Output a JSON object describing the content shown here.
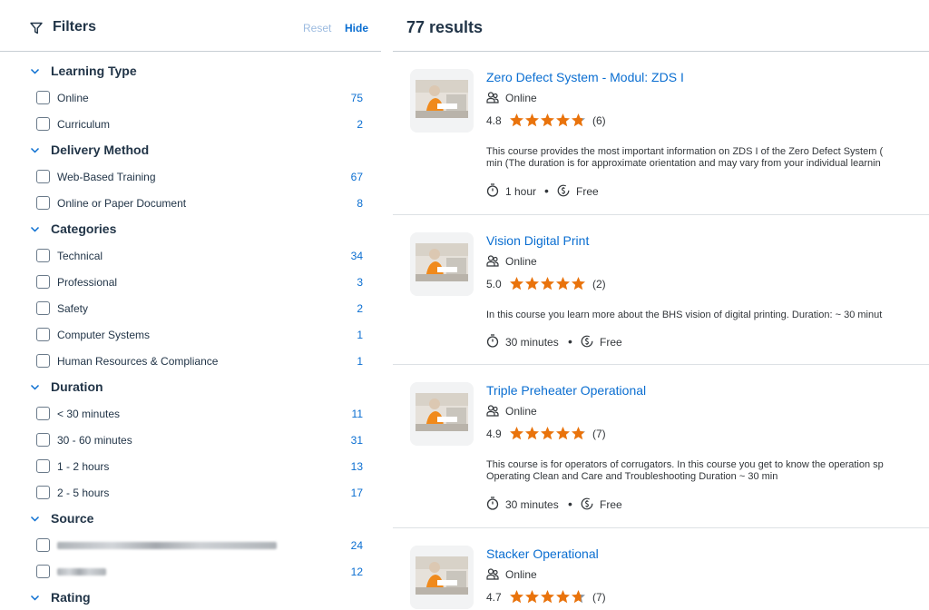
{
  "filters": {
    "title": "Filters",
    "reset_label": "Reset",
    "hide_label": "Hide",
    "groups": [
      {
        "title": "Learning Type",
        "options": [
          {
            "label": "Online",
            "count": "75"
          },
          {
            "label": "Curriculum",
            "count": "2"
          }
        ]
      },
      {
        "title": "Delivery Method",
        "options": [
          {
            "label": "Web-Based Training",
            "count": "67"
          },
          {
            "label": "Online or Paper Document",
            "count": "8"
          }
        ]
      },
      {
        "title": "Categories",
        "options": [
          {
            "label": "Technical",
            "count": "34"
          },
          {
            "label": "Professional",
            "count": "3"
          },
          {
            "label": "Safety",
            "count": "2"
          },
          {
            "label": "Computer Systems",
            "count": "1"
          },
          {
            "label": "Human Resources & Compliance",
            "count": "1"
          }
        ]
      },
      {
        "title": "Duration",
        "options": [
          {
            "label": "< 30 minutes",
            "count": "11"
          },
          {
            "label": "30 - 60 minutes",
            "count": "31"
          },
          {
            "label": "1 - 2 hours",
            "count": "13"
          },
          {
            "label": "2 - 5 hours",
            "count": "17"
          }
        ]
      },
      {
        "title": "Source",
        "options": [
          {
            "label": "",
            "count": "24",
            "blurred": true
          },
          {
            "label": "",
            "count": "12",
            "blurred": true
          }
        ]
      },
      {
        "title": "Rating",
        "options": []
      }
    ]
  },
  "results": {
    "count_label": "77 results",
    "courses": [
      {
        "title": "Zero Defect System - Modul: ZDS I",
        "type": "Online",
        "rating": "4.8",
        "rating_value": 4.8,
        "rating_count": "(6)",
        "description_lines": [
          "This course provides the most important information on ZDS I of the Zero Defect System (",
          "min (The duration is for approximate orientation and may vary from your individual learnin"
        ],
        "duration": "1 hour",
        "price": "Free"
      },
      {
        "title": "Vision Digital Print",
        "type": "Online",
        "rating": "5.0",
        "rating_value": 5.0,
        "rating_count": "(2)",
        "description_lines": [
          "In this course you learn more about the BHS vision of digital printing. Duration: ~ 30 minut"
        ],
        "duration": "30 minutes",
        "price": "Free"
      },
      {
        "title": "Triple Preheater Operational",
        "type": "Online",
        "rating": "4.9",
        "rating_value": 4.9,
        "rating_count": "(7)",
        "description_lines": [
          "This course is for operators of corrugators. In this course you get to know the operation sp",
          "Operating Clean and Care and Troubleshooting Duration ~ 30 min"
        ],
        "duration": "30 minutes",
        "price": "Free"
      },
      {
        "title": "Stacker Operational",
        "type": "Online",
        "rating": "4.7",
        "rating_value": 4.7,
        "rating_count": "(7)",
        "description_lines": [],
        "duration": "",
        "price": ""
      }
    ]
  },
  "colors": {
    "accent": "#0a6ed1",
    "star": "#e9730c",
    "star_empty": "#8396a8",
    "text": "#223548"
  }
}
